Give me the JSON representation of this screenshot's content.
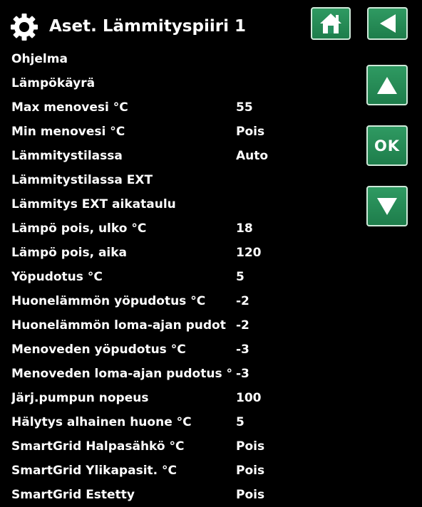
{
  "header": {
    "title": "Aset. Lämmityspiiri 1",
    "icons": [
      "gear-icon",
      "home-icon",
      "back-arrow-icon"
    ]
  },
  "nav": {
    "up_icon": "up-arrow-icon",
    "ok_label": "OK",
    "down_icon": "down-arrow-icon",
    "button_color": "#279060"
  },
  "rows": [
    {
      "label": "Ohjelma",
      "value": ""
    },
    {
      "label": "Lämpökäyrä",
      "value": ""
    },
    {
      "label": "Max menovesi °C",
      "value": "55"
    },
    {
      "label": "Min menovesi °C",
      "value": "Pois"
    },
    {
      "label": "Lämmitystilassa",
      "value": "Auto"
    },
    {
      "label": "Lämmitystilassa EXT",
      "value": ""
    },
    {
      "label": "Lämmitys EXT aikataulu",
      "value": ""
    },
    {
      "label": "Lämpö pois, ulko °C",
      "value": "18"
    },
    {
      "label": "Lämpö pois, aika",
      "value": "120"
    },
    {
      "label": "Yöpudotus °C",
      "value": "5"
    },
    {
      "label": "Huonelämmön yöpudotus °C",
      "value": "-2"
    },
    {
      "label": "Huonelämmön loma-ajan pudot",
      "value": "-2"
    },
    {
      "label": "Menoveden yöpudotus °C",
      "value": "-3"
    },
    {
      "label": "Menoveden loma-ajan pudotus °",
      "value": "-3"
    },
    {
      "label": "Järj.pumpun nopeus",
      "value": "100"
    },
    {
      "label": "Hälytys alhainen huone °C",
      "value": "5"
    },
    {
      "label": "SmartGrid Halpasähkö °C",
      "value": "Pois"
    },
    {
      "label": "SmartGrid Ylikapasit. °C",
      "value": "Pois"
    },
    {
      "label": "SmartGrid Estetty",
      "value": "Pois"
    }
  ]
}
